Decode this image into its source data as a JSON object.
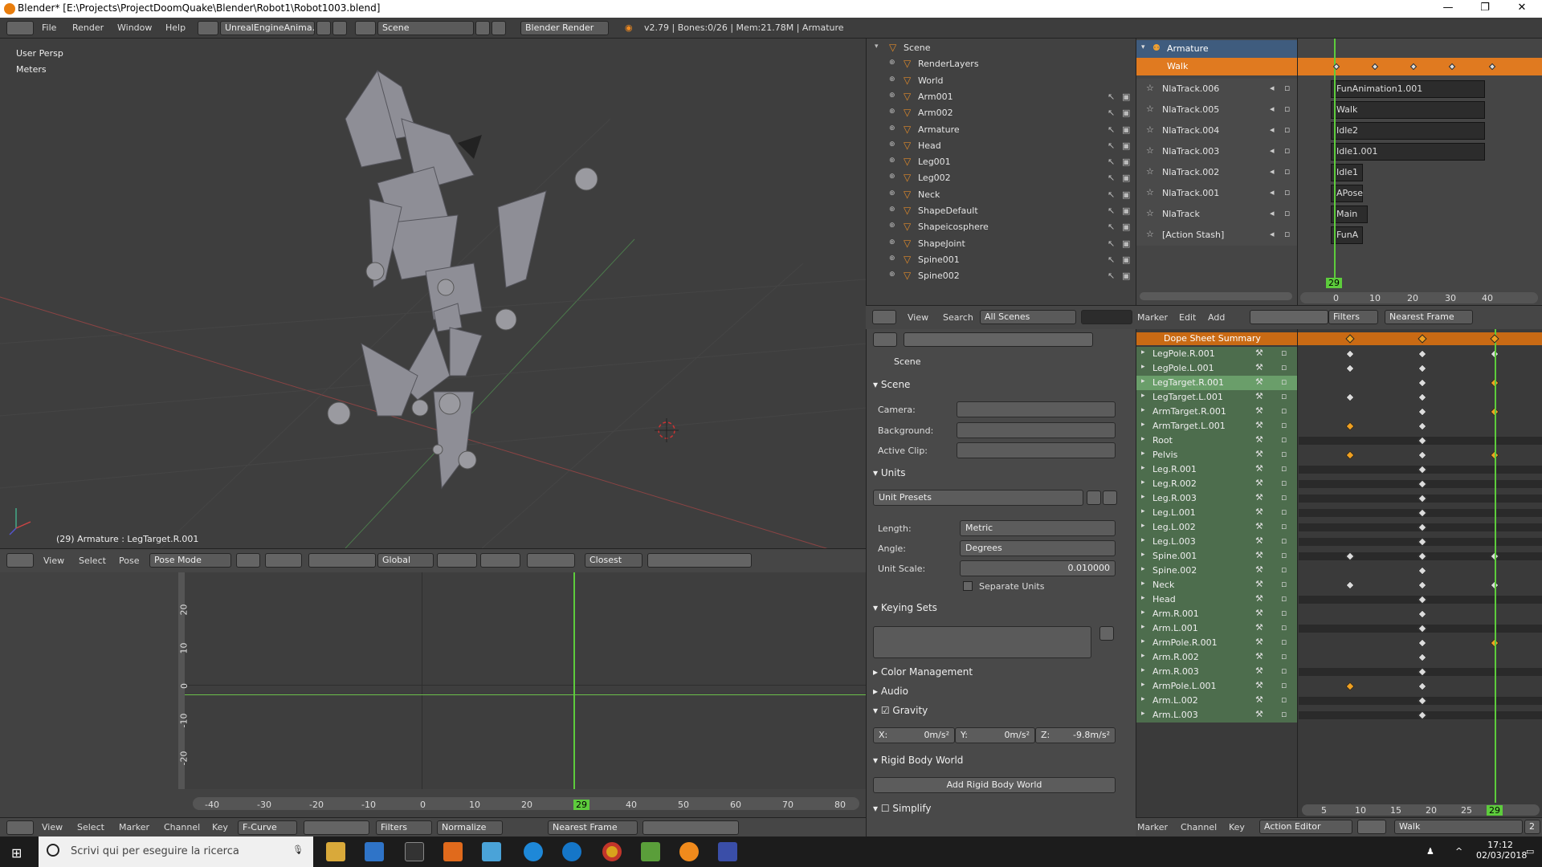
{
  "titlebar": {
    "title": "Blender* [E:\\Projects\\ProjectDoomQuake\\Blender\\Robot1\\Robot1003.blend]",
    "min": "—",
    "max": "❐",
    "close": "✕"
  },
  "infobar": {
    "menus": [
      "File",
      "Render",
      "Window",
      "Help"
    ],
    "layout": "UnrealEngineAnima...",
    "scene": "Scene",
    "engine": "Blender Render",
    "stats": "v2.79 | Bones:0/26 | Mem:21.78M | Armature"
  },
  "viewport": {
    "view_name": "User Persp",
    "units": "Meters",
    "status": "(29) Armature : LegTarget.R.001"
  },
  "header3d": {
    "menus": [
      "View",
      "Select",
      "Pose"
    ],
    "mode": "Pose Mode",
    "orientation": "Global",
    "snap": "Closest"
  },
  "graph": {
    "y_labels": [
      "20",
      "10",
      "0",
      "-10",
      "-20"
    ],
    "x_labels": [
      "-40",
      "-30",
      "-20",
      "-10",
      "0",
      "10",
      "20",
      "30",
      "40",
      "50",
      "60",
      "70",
      "80"
    ],
    "frame": "29"
  },
  "graphhdr": {
    "menus": [
      "View",
      "Select",
      "Marker",
      "Channel",
      "Key"
    ],
    "mode": "F-Curve",
    "filters": "Filters",
    "normalize": "Normalize",
    "snap": "Nearest Frame"
  },
  "outliner": {
    "items": [
      {
        "name": "Scene",
        "indent": 0
      },
      {
        "name": "RenderLayers",
        "indent": 1
      },
      {
        "name": "World",
        "indent": 1
      },
      {
        "name": "Arm001",
        "indent": 1
      },
      {
        "name": "Arm002",
        "indent": 1
      },
      {
        "name": "Armature",
        "indent": 1
      },
      {
        "name": "Head",
        "indent": 1
      },
      {
        "name": "Leg001",
        "indent": 1
      },
      {
        "name": "Leg002",
        "indent": 1
      },
      {
        "name": "Neck",
        "indent": 1
      },
      {
        "name": "ShapeDefault",
        "indent": 1
      },
      {
        "name": "Shapeicosphere",
        "indent": 1
      },
      {
        "name": "ShapeJoint",
        "indent": 1
      },
      {
        "name": "Spine001",
        "indent": 1
      },
      {
        "name": "Spine002",
        "indent": 1
      }
    ]
  },
  "outhdr": {
    "menus": [
      "View",
      "Search"
    ],
    "filter": "All Scenes"
  },
  "props": {
    "scene_label": "Scene",
    "scene_section": "Scene",
    "camera": "Camera:",
    "background": "Background:",
    "clip": "Active Clip:",
    "units_section": "Units",
    "unit_presets": "Unit Presets",
    "length_lbl": "Length:",
    "length": "Metric",
    "angle_lbl": "Angle:",
    "angle": "Degrees",
    "scale_lbl": "Unit Scale:",
    "scale": "0.010000",
    "separate": "Separate Units",
    "keying": "Keying Sets",
    "color_mgmt": "Color Management",
    "audio": "Audio",
    "gravity": "Gravity",
    "gx": "X:",
    "gxv": "0m/s²",
    "gy": "Y:",
    "gyv": "0m/s²",
    "gz": "Z:",
    "gzv": "-9.8m/s²",
    "rigid": "Rigid Body World",
    "add_rigid": "Add Rigid Body World",
    "simplify": "Simplify"
  },
  "nla": {
    "object": "Armature",
    "action": "Walk",
    "tracks": [
      {
        "name": "NlaTrack.006",
        "strip": "FunAnimation1.001"
      },
      {
        "name": "NlaTrack.005",
        "strip": "Walk"
      },
      {
        "name": "NlaTrack.004",
        "strip": "Idle2"
      },
      {
        "name": "NlaTrack.003",
        "strip": "Idle1.001"
      },
      {
        "name": "NlaTrack.002",
        "strip": "Idle1"
      },
      {
        "name": "NlaTrack.001",
        "strip": "APose"
      },
      {
        "name": "NlaTrack",
        "strip": "Main"
      },
      {
        "name": "[Action Stash]",
        "strip": "FunA"
      }
    ],
    "ticks": [
      "0",
      "10",
      "20",
      "30",
      "40"
    ],
    "frame": "29"
  },
  "nlahdr": {
    "menus": [
      "Marker",
      "Edit",
      "Add"
    ],
    "filters": "Filters",
    "snap": "Nearest Frame"
  },
  "dope": {
    "summary": "Dope Sheet Summary",
    "channels": [
      "LegPole.R.001",
      "LegPole.L.001",
      "LegTarget.R.001",
      "LegTarget.L.001",
      "ArmTarget.R.001",
      "ArmTarget.L.001",
      "Root",
      "Pelvis",
      "Leg.R.001",
      "Leg.R.002",
      "Leg.R.003",
      "Leg.L.001",
      "Leg.L.002",
      "Leg.L.003",
      "Spine.001",
      "Spine.002",
      "Neck",
      "Head",
      "Arm.R.001",
      "Arm.L.001",
      "ArmPole.R.001",
      "Arm.R.002",
      "Arm.R.003",
      "ArmPole.L.001",
      "Arm.L.002",
      "Arm.L.003"
    ],
    "ticks": [
      "5",
      "10",
      "15",
      "20",
      "25",
      "30"
    ],
    "frame": "29"
  },
  "dopehdr": {
    "menus": [
      "Marker",
      "Channel",
      "Key"
    ],
    "mode": "Action Editor",
    "action": "Walk",
    "users": "2"
  },
  "taskbar": {
    "search": "Scrivi qui per eseguire la ricerca",
    "time": "17:12",
    "date": "02/03/2018"
  }
}
